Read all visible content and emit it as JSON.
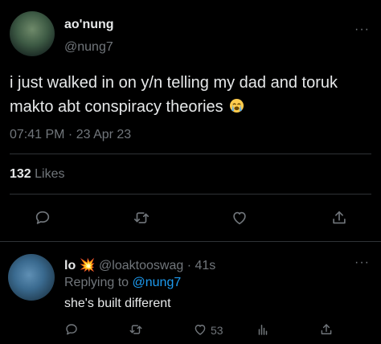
{
  "tweet": {
    "display_name": "ao'nung",
    "handle": "@nung7",
    "text": "i just walked in on y/n telling my dad and toruk makto abt conspiracy theories",
    "emoji": "crying-face-emoji",
    "timestamp": "07:41 PM · 23 Apr 23",
    "likes_count": "132",
    "likes_label": "Likes",
    "more": "···"
  },
  "reply": {
    "display_name": "lo",
    "name_emoji": "💥",
    "handle": "@loaktooswag",
    "separator": "·",
    "age": "41s",
    "replying_prefix": "Replying to",
    "replying_mention": "@nung7",
    "text": "she's built different",
    "like_count": "53",
    "more": "···"
  },
  "colors": {
    "background": "#000000",
    "text": "#e7e9ea",
    "secondary": "#71767b",
    "link": "#1d9bf0",
    "divider": "#2f3336"
  }
}
